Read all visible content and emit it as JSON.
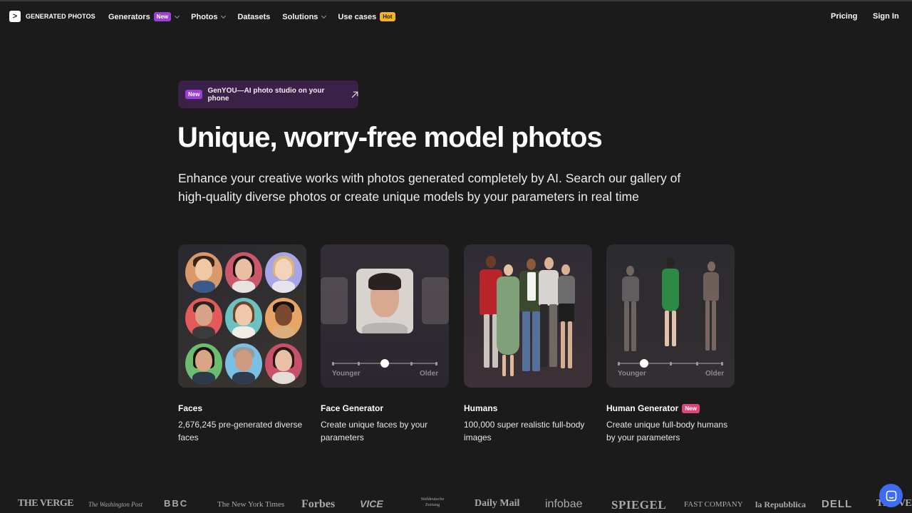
{
  "brand": {
    "name": "GENERATED PHOTOS",
    "mark": ">"
  },
  "nav": {
    "items": [
      {
        "label": "Generators",
        "tag": "New",
        "has_chevron": true
      },
      {
        "label": "Photos",
        "has_chevron": true
      },
      {
        "label": "Datasets"
      },
      {
        "label": "Solutions",
        "has_chevron": true
      },
      {
        "label": "Use cases",
        "tag": "Hot"
      }
    ],
    "pricing": "Pricing",
    "sign_in": "Sign In"
  },
  "announcement": {
    "tag": "New",
    "text": "GenYOU—AI photo studio on your phone",
    "icon": "arrow-up-right-icon"
  },
  "hero": {
    "title": "Unique, worry-free model photos",
    "subtitle_line1": "Enhance your creative works with photos generated completely by AI. Search our gallery of",
    "subtitle_line2": "high-quality diverse photos or create unique models by your parameters in real time"
  },
  "cards": [
    {
      "title": "Faces",
      "description": "2,676,245 pre-generated diverse faces"
    },
    {
      "title": "Face Generator",
      "description": "Create unique faces by your parameters",
      "slider_left": "Younger",
      "slider_right": "Older",
      "slider_value": 0.5
    },
    {
      "title": "Humans",
      "description": "100,000 super realistic full-body images"
    },
    {
      "title": "Human Generator",
      "tag": "New",
      "description": "Create unique full-body humans by your parameters",
      "slider_left": "Younger",
      "slider_right": "Older",
      "slider_value": 0.25
    }
  ],
  "press_logos": [
    "THE VERGE",
    "The Washington Post",
    "BBC",
    "The New York Times",
    "Forbes",
    "VICE",
    "Süddeutsche Zeitung",
    "Daily Mail",
    "infobae",
    "SPIEGEL",
    "FAST COMPANY",
    "la Repubblica",
    "DELL",
    "THE VERGE"
  ],
  "colors": {
    "background": "#1b1b1c",
    "new_tag": "#9b3fd6",
    "hot_tag": "#f0b429",
    "announce_bg": "#3b2147",
    "chat_button": "#3d6cf2"
  },
  "chat_icon": "chat-icon"
}
